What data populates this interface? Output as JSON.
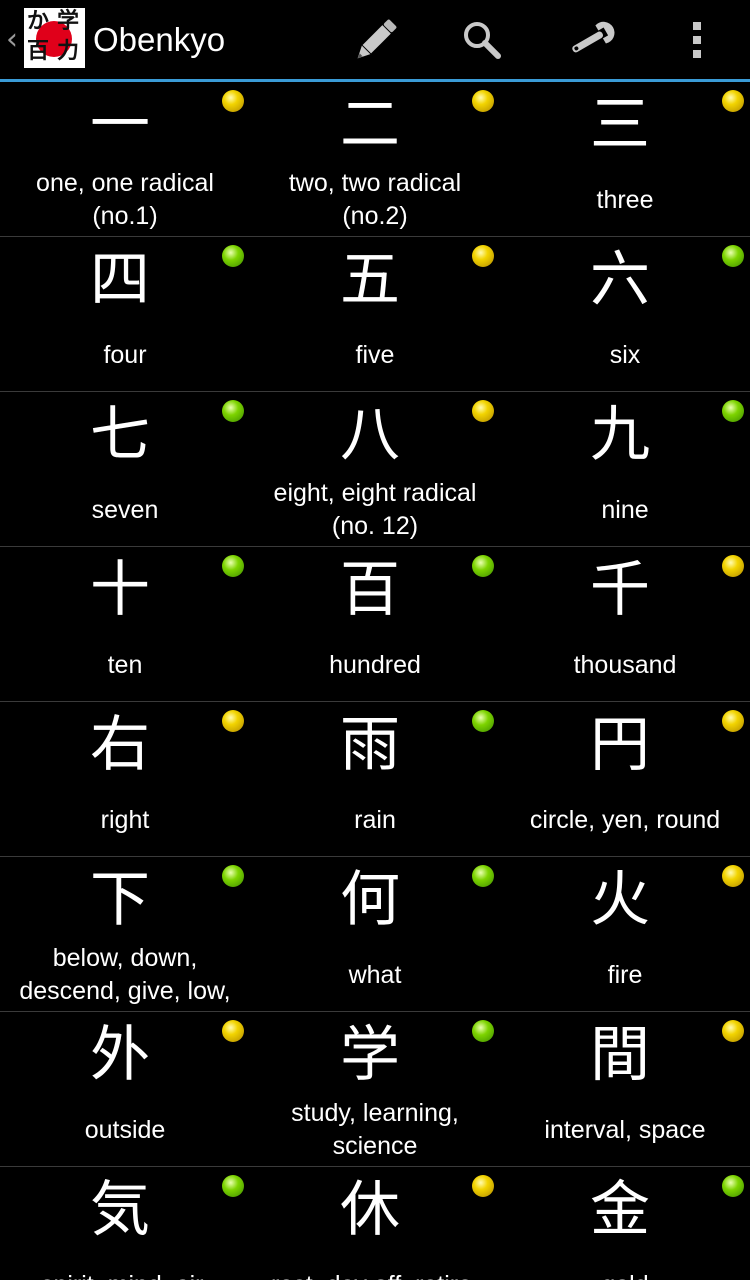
{
  "actionbar": {
    "title": "Obenkyo",
    "logo_text": [
      "か",
      "学",
      "百",
      "力"
    ],
    "actions": [
      {
        "name": "pencil-icon"
      },
      {
        "name": "search-icon"
      },
      {
        "name": "wrench-icon"
      },
      {
        "name": "overflow-menu-icon"
      }
    ],
    "accent_color": "#3a9bd6"
  },
  "kanji_grid": [
    [
      {
        "kanji": "一",
        "meaning": "one, one radical (no.1)",
        "status": "yellow"
      },
      {
        "kanji": "二",
        "meaning": "two, two radical (no.2)",
        "status": "yellow"
      },
      {
        "kanji": "三",
        "meaning": "three",
        "status": "yellow"
      }
    ],
    [
      {
        "kanji": "四",
        "meaning": "four",
        "status": "green"
      },
      {
        "kanji": "五",
        "meaning": "five",
        "status": "yellow"
      },
      {
        "kanji": "六",
        "meaning": "six",
        "status": "green"
      }
    ],
    [
      {
        "kanji": "七",
        "meaning": "seven",
        "status": "green"
      },
      {
        "kanji": "八",
        "meaning": "eight, eight radical (no. 12)",
        "status": "yellow"
      },
      {
        "kanji": "九",
        "meaning": "nine",
        "status": "green"
      }
    ],
    [
      {
        "kanji": "十",
        "meaning": "ten",
        "status": "green"
      },
      {
        "kanji": "百",
        "meaning": "hundred",
        "status": "green"
      },
      {
        "kanji": "千",
        "meaning": "thousand",
        "status": "yellow"
      }
    ],
    [
      {
        "kanji": "右",
        "meaning": "right",
        "status": "yellow"
      },
      {
        "kanji": "雨",
        "meaning": "rain",
        "status": "green"
      },
      {
        "kanji": "円",
        "meaning": "circle, yen, round",
        "status": "yellow"
      }
    ],
    [
      {
        "kanji": "下",
        "meaning": "below, down, descend, give, low,",
        "status": "green"
      },
      {
        "kanji": "何",
        "meaning": "what",
        "status": "green"
      },
      {
        "kanji": "火",
        "meaning": "fire",
        "status": "yellow"
      }
    ],
    [
      {
        "kanji": "外",
        "meaning": "outside",
        "status": "yellow"
      },
      {
        "kanji": "学",
        "meaning": "study, learning, science",
        "status": "green"
      },
      {
        "kanji": "間",
        "meaning": "interval, space",
        "status": "yellow"
      }
    ],
    [
      {
        "kanji": "気",
        "meaning": "spirit, mind, air,",
        "status": "green"
      },
      {
        "kanji": "休",
        "meaning": "rest, day off, retire,",
        "status": "yellow"
      },
      {
        "kanji": "金",
        "meaning": "gold",
        "status": "green"
      }
    ]
  ]
}
